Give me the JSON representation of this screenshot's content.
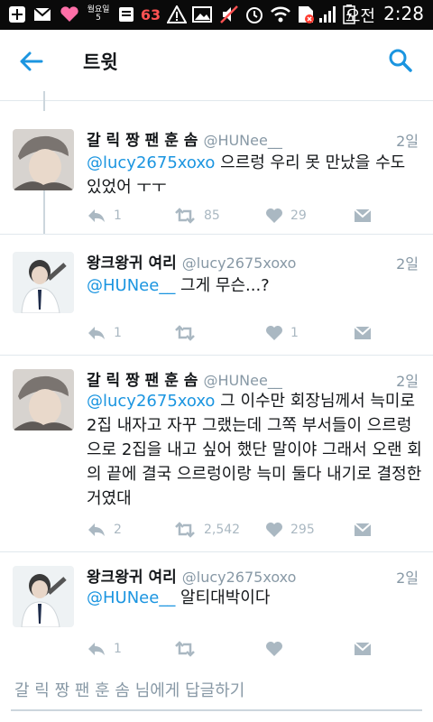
{
  "status_bar": {
    "ampm": "오전",
    "time": "2:28",
    "notification_badge": "63",
    "weather_label": "월요일 5"
  },
  "app_bar": {
    "title": "트윗"
  },
  "tweets": [
    {
      "name": "갈 릭 짱 팬 훈 솜",
      "handle": "@HUNee__",
      "date": "2일",
      "mention": "@lucy2675xoxo",
      "body": " 으르렁 우리 못 만났을 수도 있었어 ㅜㅜ",
      "replies": "1",
      "retweets": "85",
      "likes": "29"
    },
    {
      "name": "왕크왕귀 여리",
      "handle": "@lucy2675xoxo",
      "date": "2일",
      "mention": "@HUNee__",
      "body": " 그게 무슨...?",
      "replies": "1",
      "retweets": "",
      "likes": "1"
    },
    {
      "name": "갈 릭 짱 팬 훈 솜",
      "handle": "@HUNee__",
      "date": "2일",
      "mention": "@lucy2675xoxo",
      "body": " 그 이수만 회장님께서 늑미로 2집 내자고 자꾸 그랬는데 그쪽 부서들이 으르렁으로 2집을 내고 싶어 했단 말이야 그래서 오랜 회의 끝에 결국 으르렁이랑 늑미 둘다 내기로 결정한거였대",
      "replies": "2",
      "retweets": "2,542",
      "likes": "295"
    },
    {
      "name": "왕크왕귀 여리",
      "handle": "@lucy2675xoxo",
      "date": "2일",
      "mention": "@HUNee__",
      "body": " 알티대박이다",
      "replies": "1",
      "retweets": "",
      "likes": ""
    }
  ],
  "reply_bar": {
    "placeholder": "갈 릭 짱 팬 훈 솜 님에게 답글하기"
  },
  "colors": {
    "accent": "#1b95e0",
    "muted": "#aab8c2",
    "text": "#14171a",
    "status_bar": "#0a0a0a"
  }
}
